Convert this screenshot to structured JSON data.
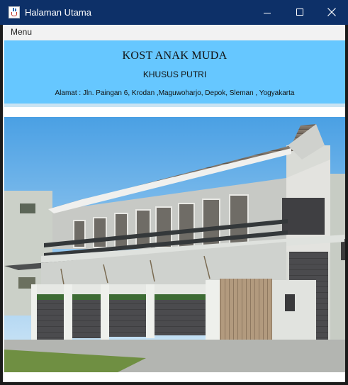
{
  "window": {
    "title": "Halaman Utama"
  },
  "menubar": {
    "items": [
      {
        "label": "Menu"
      }
    ]
  },
  "header": {
    "title": "KOST ANAK MUDA",
    "subtitle": "KHUSUS PUTRI",
    "address": "Alamat : Jln. Paingan 6, Krodan ,Maguwoharjo, Depok, Sleman , Yogyakarta"
  },
  "colors": {
    "titlebar": "#0d3068",
    "header_background": "#66c7ff",
    "menubar": "#f2f2f2"
  },
  "icons": {
    "app": "java-cup-icon",
    "minimize": "minimize-icon",
    "maximize": "maximize-icon",
    "close": "close-icon"
  }
}
